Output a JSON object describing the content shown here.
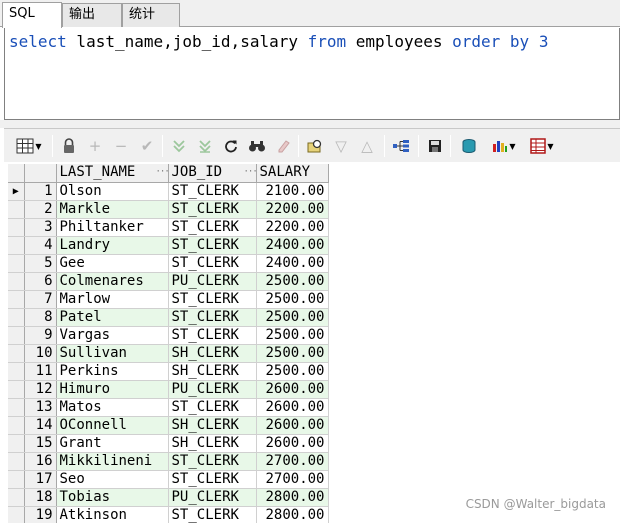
{
  "tabs": [
    {
      "label": "SQL"
    },
    {
      "label": "输出"
    },
    {
      "label": "统计"
    }
  ],
  "editor": {
    "kw_select": "select",
    "columns_text": " last_name,job_id,salary ",
    "kw_from": "from",
    "table_text": " employees ",
    "kw_order": "order by",
    "order_value": "3"
  },
  "toolbar": {
    "icons": [
      "grid-icon",
      "lock-icon",
      "add-icon",
      "remove-icon",
      "check-icon",
      "filter-down-icon",
      "filter-all-icon",
      "refresh-icon",
      "find-icon",
      "clear-icon",
      "query-icon",
      "sort-down-icon",
      "sort-up-icon",
      "tree-icon",
      "save-icon",
      "export-icon",
      "chart-icon",
      "report-icon"
    ]
  },
  "grid": {
    "headers": [
      "LAST_NAME",
      "JOB_ID",
      "SALARY"
    ],
    "rows": [
      {
        "n": "1",
        "last_name": "Olson",
        "job_id": "ST_CLERK",
        "salary": "2100.00"
      },
      {
        "n": "2",
        "last_name": "Markle",
        "job_id": "ST_CLERK",
        "salary": "2200.00"
      },
      {
        "n": "3",
        "last_name": "Philtanker",
        "job_id": "ST_CLERK",
        "salary": "2200.00"
      },
      {
        "n": "4",
        "last_name": "Landry",
        "job_id": "ST_CLERK",
        "salary": "2400.00"
      },
      {
        "n": "5",
        "last_name": "Gee",
        "job_id": "ST_CLERK",
        "salary": "2400.00"
      },
      {
        "n": "6",
        "last_name": "Colmenares",
        "job_id": "PU_CLERK",
        "salary": "2500.00"
      },
      {
        "n": "7",
        "last_name": "Marlow",
        "job_id": "ST_CLERK",
        "salary": "2500.00"
      },
      {
        "n": "8",
        "last_name": "Patel",
        "job_id": "ST_CLERK",
        "salary": "2500.00"
      },
      {
        "n": "9",
        "last_name": "Vargas",
        "job_id": "ST_CLERK",
        "salary": "2500.00"
      },
      {
        "n": "10",
        "last_name": "Sullivan",
        "job_id": "SH_CLERK",
        "salary": "2500.00"
      },
      {
        "n": "11",
        "last_name": "Perkins",
        "job_id": "SH_CLERK",
        "salary": "2500.00"
      },
      {
        "n": "12",
        "last_name": "Himuro",
        "job_id": "PU_CLERK",
        "salary": "2600.00"
      },
      {
        "n": "13",
        "last_name": "Matos",
        "job_id": "ST_CLERK",
        "salary": "2600.00"
      },
      {
        "n": "14",
        "last_name": "OConnell",
        "job_id": "SH_CLERK",
        "salary": "2600.00"
      },
      {
        "n": "15",
        "last_name": "Grant",
        "job_id": "SH_CLERK",
        "salary": "2600.00"
      },
      {
        "n": "16",
        "last_name": "Mikkilineni",
        "job_id": "ST_CLERK",
        "salary": "2700.00"
      },
      {
        "n": "17",
        "last_name": "Seo",
        "job_id": "ST_CLERK",
        "salary": "2700.00"
      },
      {
        "n": "18",
        "last_name": "Tobias",
        "job_id": "PU_CLERK",
        "salary": "2800.00"
      },
      {
        "n": "19",
        "last_name": "Atkinson",
        "job_id": "ST_CLERK",
        "salary": "2800.00"
      }
    ]
  },
  "watermark": "CSDN @Walter_bigdata",
  "colors": {
    "keyword": "#1a4fb8",
    "alt_row": "#e8f8e8"
  }
}
